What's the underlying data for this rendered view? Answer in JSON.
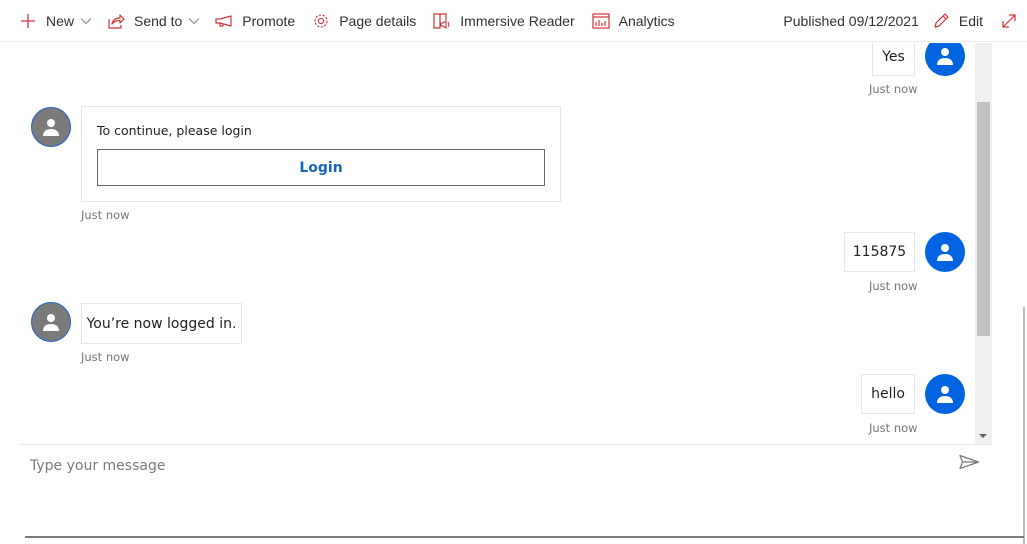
{
  "toolbar": {
    "left": [
      {
        "id": "new",
        "label": "New",
        "icon": "plus-icon",
        "has_dropdown": true
      },
      {
        "id": "send-to",
        "label": "Send to",
        "icon": "share-icon",
        "has_dropdown": true
      },
      {
        "id": "promote",
        "label": "Promote",
        "icon": "megaphone-icon",
        "has_dropdown": false
      },
      {
        "id": "page-details",
        "label": "Page details",
        "icon": "gear-icon",
        "has_dropdown": false
      },
      {
        "id": "immersive-reader",
        "label": "Immersive Reader",
        "icon": "immersive-reader-icon",
        "has_dropdown": false
      },
      {
        "id": "analytics",
        "label": "Analytics",
        "icon": "analytics-icon",
        "has_dropdown": false
      }
    ],
    "published": "Published 09/12/2021",
    "edit_label": "Edit",
    "expand_icon": "expand-icon",
    "accent_color": "#d13438"
  },
  "chat": {
    "messages": [
      {
        "sender": "user",
        "text": "Yes",
        "timestamp": "Just now"
      },
      {
        "sender": "bot",
        "type": "card",
        "text": "To continue, please login",
        "button": "Login",
        "timestamp": "Just now"
      },
      {
        "sender": "user",
        "text": "115875",
        "timestamp": "Just now"
      },
      {
        "sender": "bot",
        "text": "You’re now logged in.",
        "timestamp": "Just now"
      },
      {
        "sender": "user",
        "text": "hello",
        "timestamp": "Just now"
      }
    ],
    "user_avatar_color": "#0063e0",
    "bot_avatar_color": "#7a7a7a",
    "link_color": "#1565c0"
  },
  "composer": {
    "placeholder": "Type your message",
    "value": "",
    "send_icon": "send-icon"
  }
}
